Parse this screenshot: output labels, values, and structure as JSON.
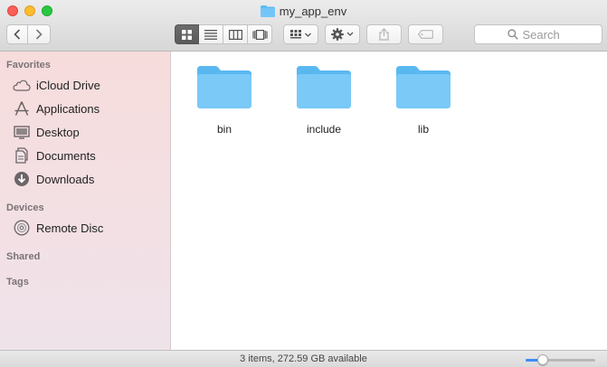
{
  "window": {
    "title": "my_app_env"
  },
  "search": {
    "placeholder": "Search"
  },
  "sidebar": {
    "sections": [
      {
        "title": "Favorites",
        "items": [
          {
            "label": "iCloud Drive",
            "icon": "cloud-icon"
          },
          {
            "label": "Applications",
            "icon": "applications-icon"
          },
          {
            "label": "Desktop",
            "icon": "desktop-icon"
          },
          {
            "label": "Documents",
            "icon": "documents-icon"
          },
          {
            "label": "Downloads",
            "icon": "downloads-icon"
          }
        ]
      },
      {
        "title": "Devices",
        "items": [
          {
            "label": "Remote Disc",
            "icon": "disc-icon"
          }
        ]
      },
      {
        "title": "Shared",
        "items": []
      },
      {
        "title": "Tags",
        "items": []
      }
    ]
  },
  "files": [
    {
      "name": "bin",
      "icon": "folder-icon"
    },
    {
      "name": "include",
      "icon": "folder-icon"
    },
    {
      "name": "lib",
      "icon": "folder-icon"
    }
  ],
  "status": {
    "text": "3 items, 272.59 GB available",
    "icon_size": 0.25
  },
  "colors": {
    "folder": "#5dbcf4",
    "accent": "#3b8df4"
  }
}
